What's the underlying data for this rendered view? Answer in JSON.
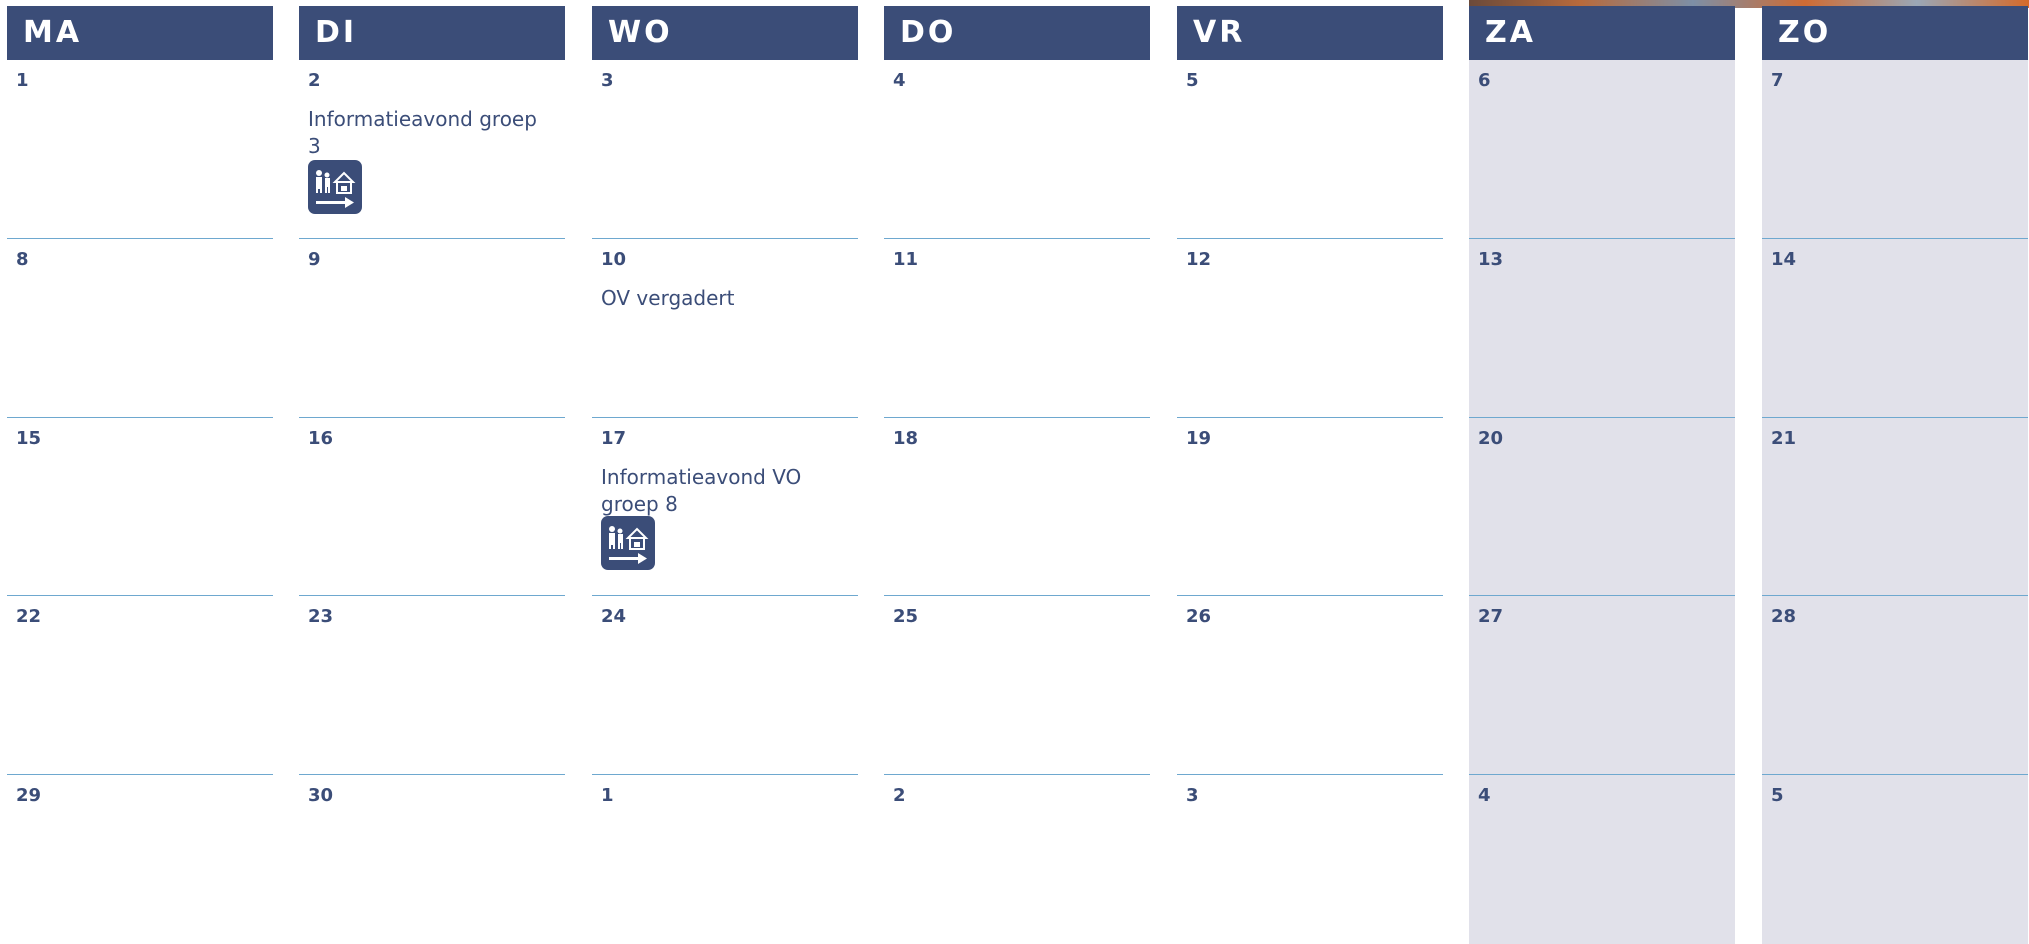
{
  "columns": [
    {
      "key": "ma",
      "label": "MA",
      "weekend": false,
      "dates": [
        "1",
        "8",
        "15",
        "22",
        "29"
      ]
    },
    {
      "key": "di",
      "label": "DI",
      "weekend": false,
      "dates": [
        "2",
        "9",
        "16",
        "23",
        "30"
      ]
    },
    {
      "key": "wo",
      "label": "WO",
      "weekend": false,
      "dates": [
        "3",
        "10",
        "17",
        "24",
        "1"
      ]
    },
    {
      "key": "do",
      "label": "DO",
      "weekend": false,
      "dates": [
        "4",
        "11",
        "18",
        "25",
        "2"
      ]
    },
    {
      "key": "vr",
      "label": "VR",
      "weekend": false,
      "dates": [
        "5",
        "12",
        "19",
        "26",
        "3"
      ]
    },
    {
      "key": "za",
      "label": "ZA",
      "weekend": true,
      "dates": [
        "6",
        "13",
        "20",
        "27",
        "4"
      ]
    },
    {
      "key": "zo",
      "label": "ZO",
      "weekend": true,
      "dates": [
        "7",
        "14",
        "21",
        "28",
        "5"
      ]
    }
  ],
  "events": [
    {
      "col": 1,
      "row": 0,
      "text": "Informatieavond groep 3",
      "icon": "parents-school-icon"
    },
    {
      "col": 2,
      "row": 1,
      "text": "OV vergadert",
      "icon": null
    },
    {
      "col": 2,
      "row": 2,
      "text": "Informatieavond VO\ngroep 8",
      "icon": "parents-school-icon"
    }
  ],
  "colors": {
    "header": "#3b4d78",
    "weekend": "#e1e1ea",
    "divider": "#6ea8cf",
    "text": "#3b4d78"
  }
}
